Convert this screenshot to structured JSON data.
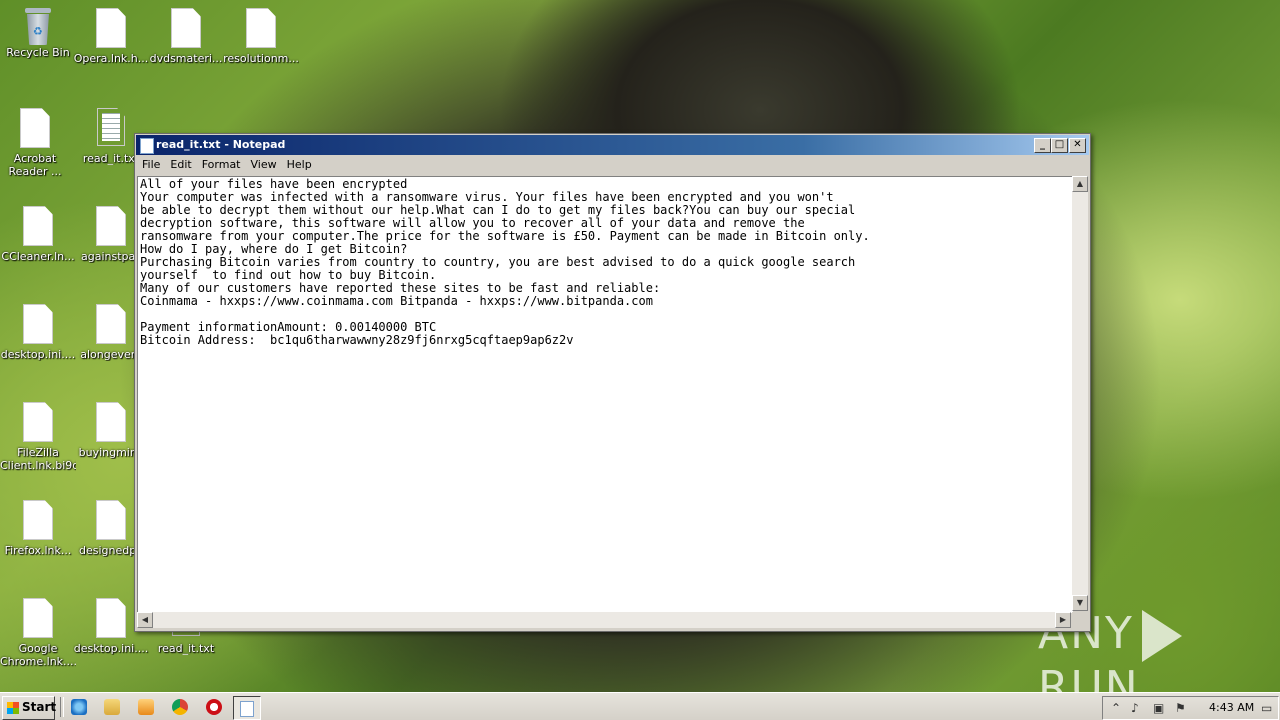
{
  "desktop": {
    "icons": [
      {
        "label": "Recycle Bin",
        "icon": "recycle-bin-icon"
      },
      {
        "label": "Opera.lnk.h...",
        "icon": "file-icon"
      },
      {
        "label": "dvdsmateri...",
        "icon": "file-icon"
      },
      {
        "label": "resolutionm...",
        "icon": "file-icon"
      },
      {
        "label": "Acrobat Reader ...",
        "icon": "file-icon"
      },
      {
        "label": "read_it.txt",
        "icon": "text-file-icon"
      },
      {
        "label": "CCleaner.ln...",
        "icon": "file-icon"
      },
      {
        "label": "againstpas",
        "icon": "file-icon"
      },
      {
        "label": "desktop.ini....",
        "icon": "file-icon"
      },
      {
        "label": "alongevery",
        "icon": "file-icon"
      },
      {
        "label": "FileZilla Client.lnk.bi9d",
        "icon": "file-icon"
      },
      {
        "label": "buyingmini.",
        "icon": "file-icon"
      },
      {
        "label": "Firefox.lnk...",
        "icon": "file-icon"
      },
      {
        "label": "designedpa",
        "icon": "file-icon"
      },
      {
        "label": "Google Chrome.lnk....",
        "icon": "file-icon"
      },
      {
        "label": "desktop.ini....",
        "icon": "file-icon"
      },
      {
        "label": "read_it.txt",
        "icon": "text-file-icon"
      }
    ]
  },
  "notepad": {
    "title": "read_it.txt - Notepad",
    "menu": [
      "File",
      "Edit",
      "Format",
      "View",
      "Help"
    ],
    "content": "All of your files have been encrypted\nYour computer was infected with a ransomware virus. Your files have been encrypted and you won't\nbe able to decrypt them without our help.What can I do to get my files back?You can buy our special\ndecryption software, this software will allow you to recover all of your data and remove the\nransomware from your computer.The price for the software is £50. Payment can be made in Bitcoin only.\nHow do I pay, where do I get Bitcoin?\nPurchasing Bitcoin varies from country to country, you are best advised to do a quick google search\nyourself  to find out how to buy Bitcoin.\nMany of our customers have reported these sites to be fast and reliable:\nCoinmama - hxxps://www.coinmama.com Bitpanda - hxxps://www.bitpanda.com\n\nPayment informationAmount: 0.00140000 BTC\nBitcoin Address:  bc1qu6tharwawwny28z9fj6nrxg5cqftaep9ap6z2v"
  },
  "taskbar": {
    "start_label": "Start",
    "clock": "4:43 AM",
    "quicklaunch": [
      "internet-explorer-icon",
      "file-explorer-icon",
      "media-player-icon",
      "chrome-icon",
      "opera-icon"
    ]
  },
  "watermark": {
    "left": "ANY",
    "right": "RUN"
  }
}
